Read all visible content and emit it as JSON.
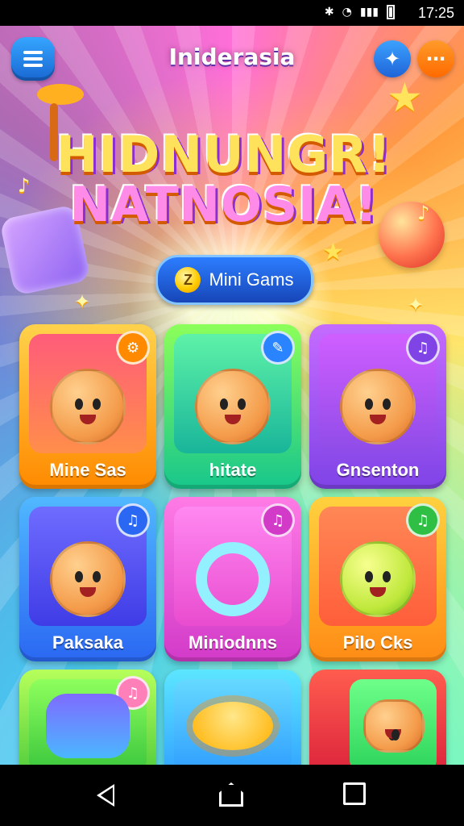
{
  "status_bar": {
    "time": "17:25"
  },
  "header": {
    "title": "Iniderasia",
    "menu_icon": "menu-icon",
    "game_icon": "gamepad-icon",
    "more_icon": "more-icon"
  },
  "hero": {
    "line1": "HIDNUNGR!",
    "line2": "NATNOSIA!"
  },
  "mini_games_button": {
    "label": "Mini Gams"
  },
  "cards": [
    {
      "label": "Mine Sas",
      "badge": "gear-icon"
    },
    {
      "label": "hitate",
      "badge": "pencil-icon"
    },
    {
      "label": "Gnsenton",
      "badge": "music-icon"
    },
    {
      "label": "Paksaka",
      "badge": "music-icon"
    },
    {
      "label": "Miniodnns",
      "badge": "music-icon"
    },
    {
      "label": "Pilo Cks",
      "badge": "music-icon"
    },
    {
      "label": "",
      "badge": "music-icon"
    },
    {
      "label": "",
      "badge": ""
    },
    {
      "label": "",
      "badge": ""
    }
  ]
}
